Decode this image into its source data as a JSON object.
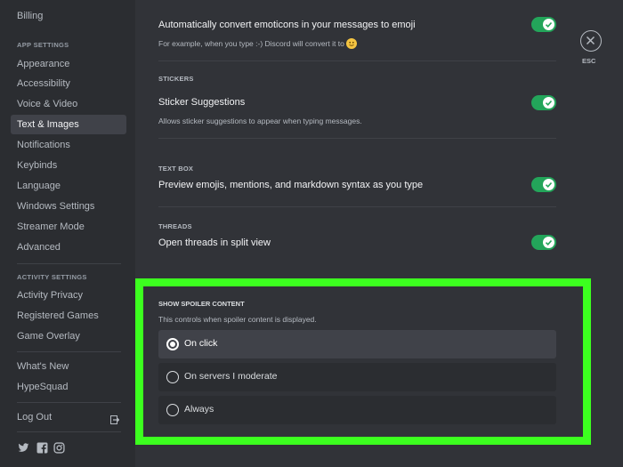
{
  "sidebar": {
    "top_item": "Billing",
    "app_settings_header": "APP SETTINGS",
    "app_items": [
      "Appearance",
      "Accessibility",
      "Voice & Video",
      "Text & Images",
      "Notifications",
      "Keybinds",
      "Language",
      "Windows Settings",
      "Streamer Mode",
      "Advanced"
    ],
    "active_item": "Text & Images",
    "activity_header": "ACTIVITY SETTINGS",
    "activity_items": [
      "Activity Privacy",
      "Registered Games",
      "Game Overlay"
    ],
    "misc_items": [
      "What's New",
      "HypeSquad"
    ],
    "logout": "Log Out",
    "social_icons": [
      "twitter-icon",
      "facebook-icon",
      "instagram-icon"
    ]
  },
  "main": {
    "emoticons": {
      "title": "Automatically convert emoticons in your messages to emoji",
      "desc": "For example, when you type :-) Discord will convert it to",
      "enabled": true
    },
    "stickers": {
      "label": "STICKERS",
      "title": "Sticker Suggestions",
      "desc": "Allows sticker suggestions to appear when typing messages.",
      "enabled": true
    },
    "textbox": {
      "label": "TEXT BOX",
      "title": "Preview emojis, mentions, and markdown syntax as you type",
      "enabled": true
    },
    "threads": {
      "label": "THREADS",
      "title": "Open threads in split view",
      "enabled": true
    },
    "spoiler": {
      "label": "SHOW SPOILER CONTENT",
      "desc": "This controls when spoiler content is displayed.",
      "options": [
        "On click",
        "On servers I moderate",
        "Always"
      ],
      "selected": "On click"
    },
    "esc_label": "ESC",
    "highlight_color": "#3cff1f",
    "toggle_color": "#23a55a"
  }
}
